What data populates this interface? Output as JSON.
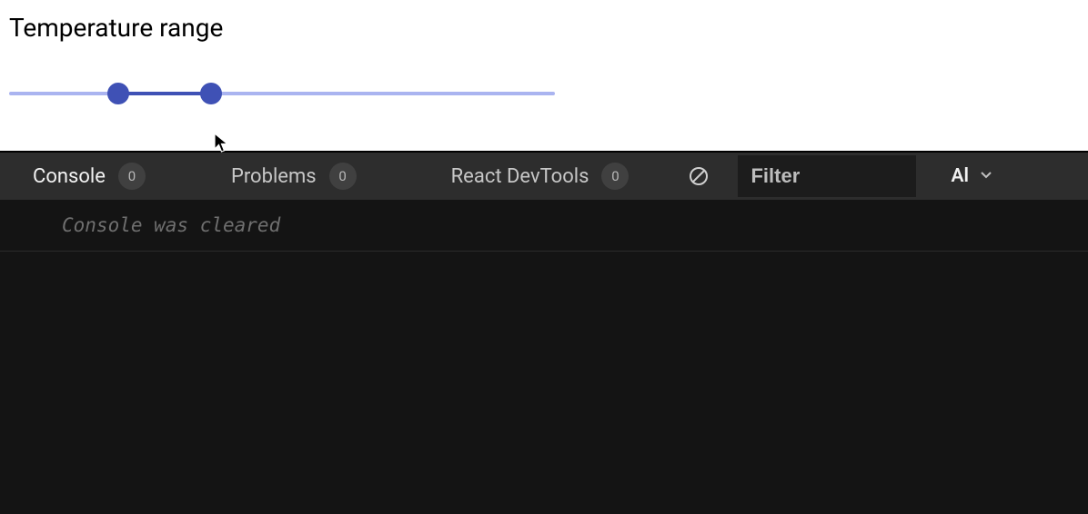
{
  "slider": {
    "title": "Temperature range",
    "min": 0,
    "max": 100,
    "low": 20,
    "high": 37,
    "colors": {
      "rail": "#aab4f0",
      "track": "#3f51b5",
      "thumb": "#3f51b5"
    }
  },
  "devtools": {
    "tabs": [
      {
        "label": "Console",
        "badge": "0",
        "active": true
      },
      {
        "label": "Problems",
        "badge": "0",
        "active": false
      },
      {
        "label": "React DevTools",
        "badge": "0",
        "active": false
      }
    ],
    "clear_tooltip": "Clear console",
    "filter_placeholder": "Filter",
    "level_label": "Al",
    "console_message": "Console was cleared"
  }
}
